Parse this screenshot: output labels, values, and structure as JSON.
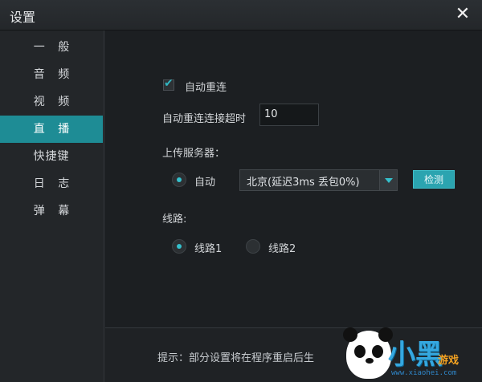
{
  "window": {
    "title": "设置"
  },
  "sidebar": {
    "items": [
      {
        "label": "一 般"
      },
      {
        "label": "音 频"
      },
      {
        "label": "视 频"
      },
      {
        "label": "直 播",
        "active": true
      },
      {
        "label": "快捷键"
      },
      {
        "label": "日 志"
      },
      {
        "label": "弹 幕"
      }
    ]
  },
  "live": {
    "auto_reconnect": {
      "label": "自动重连",
      "checked": true
    },
    "reconnect_timeout": {
      "label": "自动重连连接超时",
      "value": "10"
    },
    "upload_server": {
      "label": "上传服务器：",
      "auto_label": "自动",
      "auto_selected": true,
      "selected_server": "北京(延迟3ms 丢包0%)",
      "detect_label": "检测"
    },
    "route": {
      "label": "线路:",
      "options": [
        {
          "label": "线路1",
          "selected": true
        },
        {
          "label": "线路2",
          "selected": false
        }
      ]
    }
  },
  "footer": {
    "hint": "提示：部分设置将在程序重启后生"
  },
  "watermark": {
    "brand": "小黑",
    "sub": "游戏",
    "url": "www.xiaohei.com"
  },
  "colors": {
    "accent": "#1e8c95",
    "button": "#2ba4b0"
  }
}
